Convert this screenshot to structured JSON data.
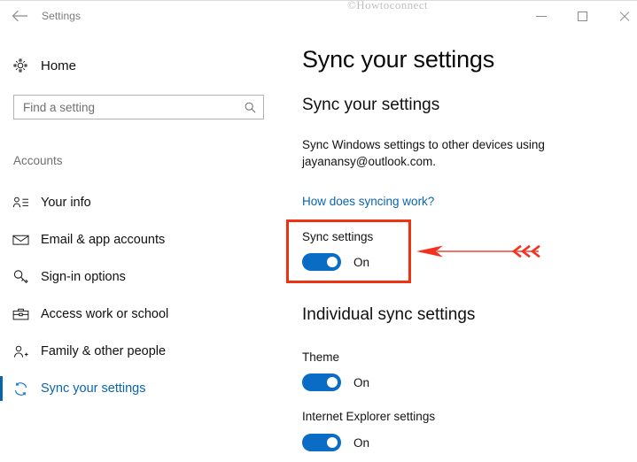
{
  "window": {
    "app_title": "Settings",
    "watermark": "©Howtoconnect",
    "back_icon": "back-arrow-icon",
    "controls": {
      "minimize": "minimize-icon",
      "maximize": "maximize-icon",
      "close": "close-icon"
    }
  },
  "sidebar": {
    "home_label": "Home",
    "home_icon": "gear-icon",
    "search": {
      "placeholder": "Find a setting",
      "value": "",
      "icon": "search-icon"
    },
    "group_title": "Accounts",
    "items": [
      {
        "label": "Your info",
        "icon": "person-info-icon",
        "selected": false
      },
      {
        "label": "Email & app accounts",
        "icon": "envelope-icon",
        "selected": false
      },
      {
        "label": "Sign-in options",
        "icon": "key-icon",
        "selected": false
      },
      {
        "label": "Access work or school",
        "icon": "briefcase-icon",
        "selected": false
      },
      {
        "label": "Family & other people",
        "icon": "person-add-icon",
        "selected": false
      },
      {
        "label": "Sync your settings",
        "icon": "sync-refresh-icon",
        "selected": true
      }
    ]
  },
  "main": {
    "page_title": "Sync your settings",
    "section_one_title": "Sync your settings",
    "description": "Sync Windows settings to other devices using jayanansy@outlook.com.",
    "link_label": "How does syncing work?",
    "sync_setting": {
      "label": "Sync settings",
      "state": "On"
    },
    "section_two_title": "Individual sync settings",
    "individual": [
      {
        "label": "Theme",
        "state": "On"
      },
      {
        "label": "Internet Explorer settings",
        "state": "On"
      }
    ]
  },
  "annotation": {
    "highlight_color": "#ee3311",
    "arrow_color": "#f44336",
    "arrow_direction": "points-left-at-sync-settings"
  },
  "colors": {
    "accent": "#0a64ad",
    "toggle_on": "#0a6cc4",
    "link": "#0a64ad",
    "annotation_red": "#ee3311"
  }
}
